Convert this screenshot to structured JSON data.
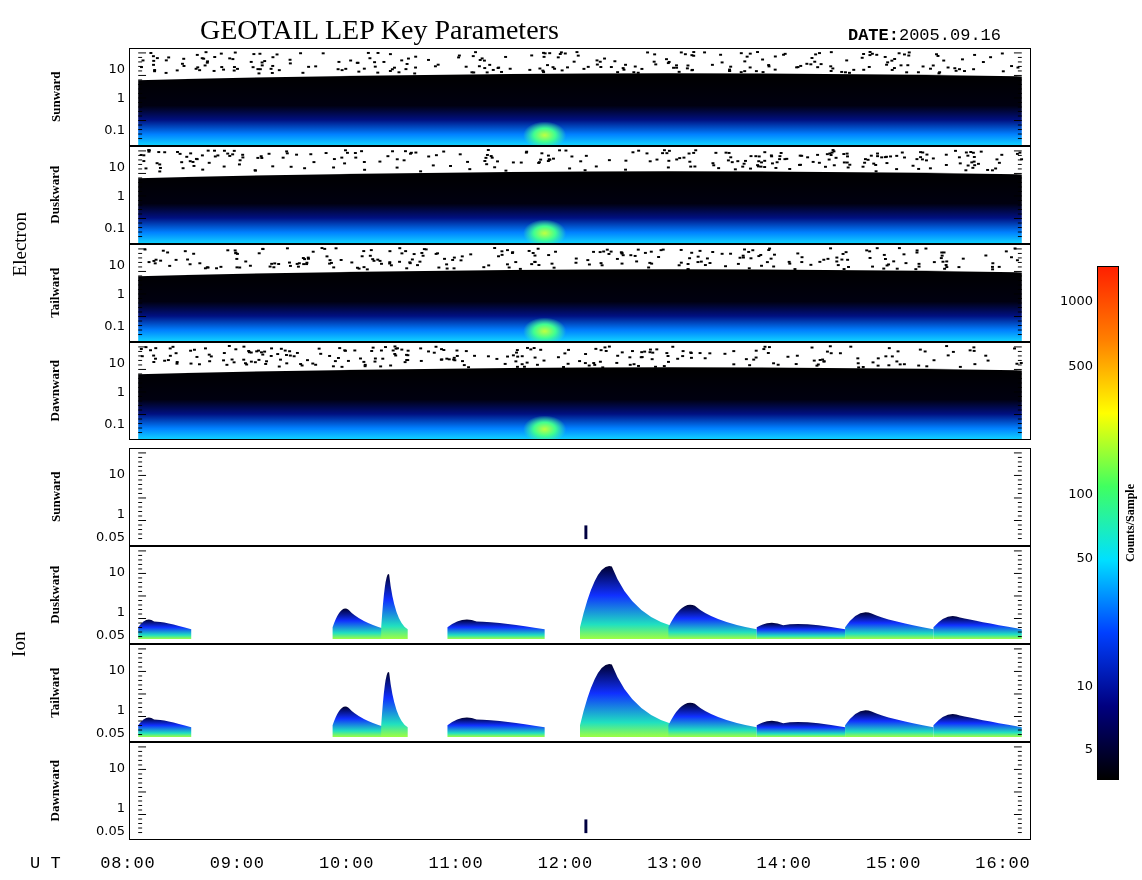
{
  "title": "GEOTAIL LEP Key Parameters",
  "date_label": "DATE:",
  "date": "2005.09.16",
  "groups": [
    {
      "label": "Electron",
      "kind": "electron",
      "panels": [
        {
          "label": "Sunward",
          "kind": "dense",
          "yticks": [
            "10",
            "1",
            "0.1"
          ]
        },
        {
          "label": "Duskward",
          "kind": "dense",
          "yticks": [
            "10",
            "1",
            "0.1"
          ]
        },
        {
          "label": "Tailward",
          "kind": "dense",
          "yticks": [
            "10",
            "1",
            "0.1"
          ]
        },
        {
          "label": "Dawnward",
          "kind": "dense",
          "yticks": [
            "10",
            "1",
            "0.1"
          ]
        }
      ]
    },
    {
      "label": "Ion",
      "kind": "ion",
      "panels": [
        {
          "label": "Sunward",
          "kind": "sparse",
          "yticks": [
            "10",
            "1",
            "0.05"
          ]
        },
        {
          "label": "Duskward",
          "kind": "patchy",
          "yticks": [
            "10",
            "1",
            "0.05"
          ]
        },
        {
          "label": "Tailward",
          "kind": "patchy",
          "yticks": [
            "10",
            "1",
            "0.05"
          ]
        },
        {
          "label": "Dawnward",
          "kind": "sparse",
          "yticks": [
            "10",
            "1",
            "0.05"
          ]
        }
      ]
    }
  ],
  "xaxis": {
    "label": "U T",
    "ticks": [
      "08:00",
      "09:00",
      "10:00",
      "11:00",
      "12:00",
      "13:00",
      "14:00",
      "15:00",
      "16:00"
    ]
  },
  "colorbar": {
    "label": "Counts/Sample",
    "ticks": [
      "1000",
      "500",
      "100",
      "50",
      "10",
      "5"
    ]
  }
}
